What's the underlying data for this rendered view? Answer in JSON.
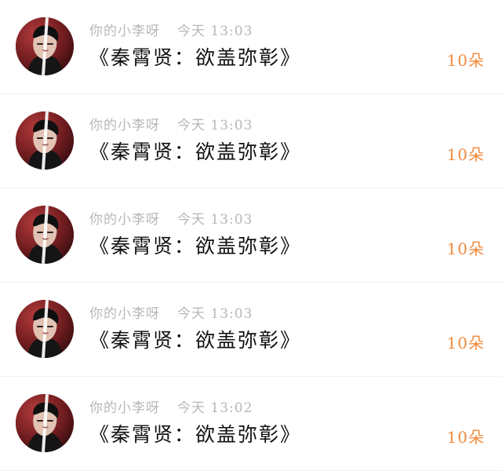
{
  "feed": {
    "items": [
      {
        "username": "你的小李呀",
        "time": "今天 13:03",
        "title": "《秦霄贤：欲盖弥彰》",
        "count": "10朵"
      },
      {
        "username": "你的小李呀",
        "time": "今天 13:03",
        "title": "《秦霄贤：欲盖弥彰》",
        "count": "10朵"
      },
      {
        "username": "你的小李呀",
        "time": "今天 13:03",
        "title": "《秦霄贤：欲盖弥彰》",
        "count": "10朵"
      },
      {
        "username": "你的小李呀",
        "time": "今天 13:03",
        "title": "《秦霄贤：欲盖弥彰》",
        "count": "10朵"
      },
      {
        "username": "你的小李呀",
        "time": "今天 13:02",
        "title": "《秦霄贤：欲盖弥彰》",
        "count": "10朵"
      }
    ]
  },
  "colors": {
    "accent": "#f28a3c",
    "meta_text": "#b7b7b7",
    "title_text": "#111111",
    "divider": "#f1f1f1"
  }
}
